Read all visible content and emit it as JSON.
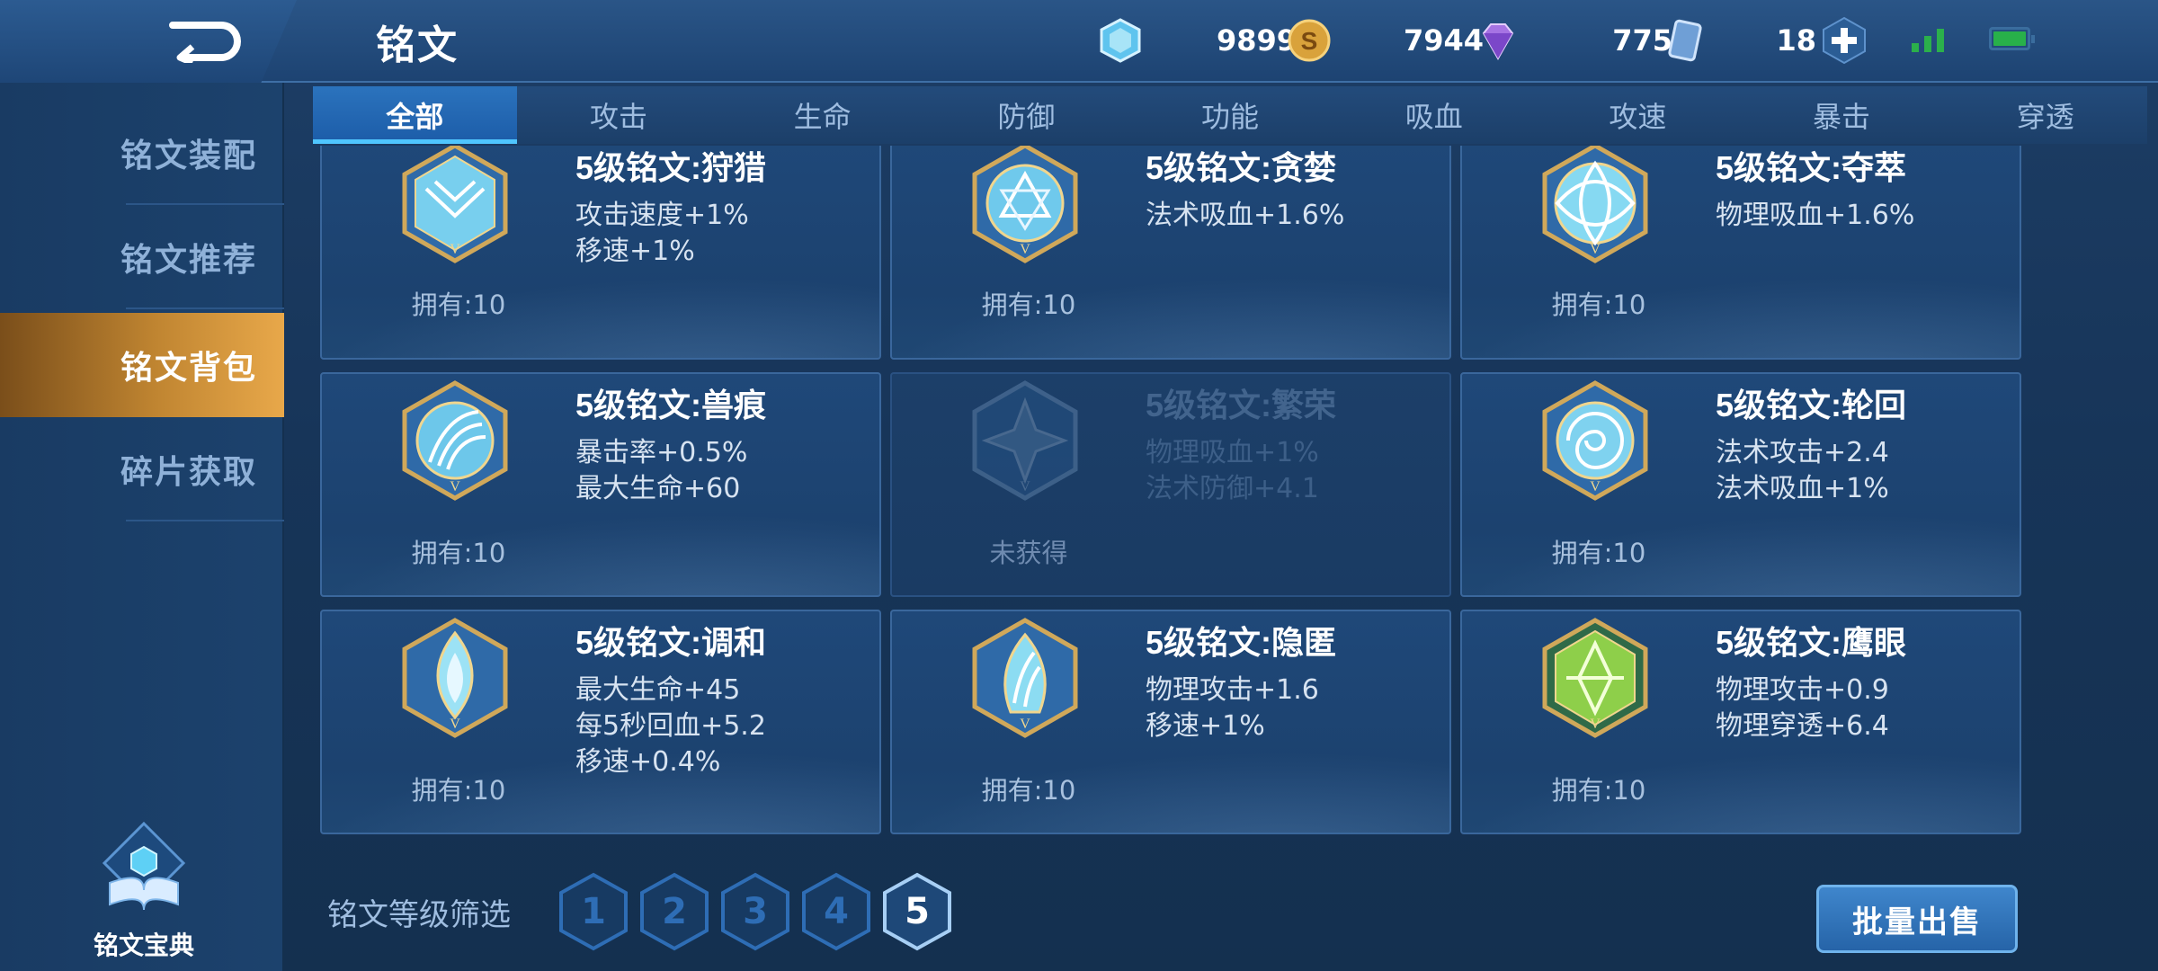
{
  "header": {
    "title": "铭文",
    "currencies": [
      {
        "icon": "crystal-icon",
        "value": "9899"
      },
      {
        "icon": "gold-coin-icon",
        "value": "7944"
      },
      {
        "icon": "diamond-icon",
        "value": "775"
      },
      {
        "icon": "card-ticket-icon",
        "value": "18"
      }
    ]
  },
  "tabs": [
    "全部",
    "攻击",
    "生命",
    "防御",
    "功能",
    "吸血",
    "攻速",
    "暴击",
    "穿透"
  ],
  "active_tab": "全部",
  "sidebar": {
    "items": [
      "铭文装配",
      "铭文推荐",
      "铭文背包",
      "碎片获取"
    ],
    "active": "铭文背包",
    "codex_label": "铭文宝典"
  },
  "cards": [
    {
      "name": "5级铭文:狩猎",
      "attrs": [
        "攻击速度+1%",
        "移速+1%"
      ],
      "owned": "拥有:10",
      "rune_color": "#8fdcf2",
      "owned_flag": true
    },
    {
      "name": "5级铭文:贪婪",
      "attrs": [
        "法术吸血+1.6%"
      ],
      "owned": "拥有:10",
      "rune_color": "#7fd4f0",
      "owned_flag": true
    },
    {
      "name": "5级铭文:夺萃",
      "attrs": [
        "物理吸血+1.6%"
      ],
      "owned": "拥有:10",
      "rune_color": "#8edcf3",
      "owned_flag": true
    },
    {
      "name": "5级铭文:兽痕",
      "attrs": [
        "暴击率+0.5%",
        "最大生命+60"
      ],
      "owned": "拥有:10",
      "rune_color": "#86d6f0",
      "owned_flag": true
    },
    {
      "name": "5级铭文:繁荣",
      "attrs": [
        "物理吸血+1%",
        "法术防御+4.1"
      ],
      "owned": "未获得",
      "rune_color": "#5f89b5",
      "owned_flag": false
    },
    {
      "name": "5级铭文:轮回",
      "attrs": [
        "法术攻击+2.4",
        "法术吸血+1%"
      ],
      "owned": "拥有:10",
      "rune_color": "#7fd2ef",
      "owned_flag": true
    },
    {
      "name": "5级铭文:调和",
      "attrs": [
        "最大生命+45",
        "每5秒回血+5.2",
        "移速+0.4%"
      ],
      "owned": "拥有:10",
      "rune_color": "#9ce2f5",
      "owned_flag": true
    },
    {
      "name": "5级铭文:隐匿",
      "attrs": [
        "物理攻击+1.6",
        "移速+1%"
      ],
      "owned": "拥有:10",
      "rune_color": "#8cdcf2",
      "owned_flag": true
    },
    {
      "name": "5级铭文:鹰眼",
      "attrs": [
        "物理攻击+0.9",
        "物理穿透+6.4"
      ],
      "owned": "拥有:10",
      "rune_color": "#8ecf4a",
      "owned_flag": true
    }
  ],
  "filter": {
    "label": "铭文等级筛选",
    "levels": [
      "1",
      "2",
      "3",
      "4",
      "5"
    ],
    "active": "5"
  },
  "batch_sell_label": "批量出售",
  "colors": {
    "accent": "#4fc6ff",
    "active_side": "#c08531",
    "bg": "#173559"
  }
}
